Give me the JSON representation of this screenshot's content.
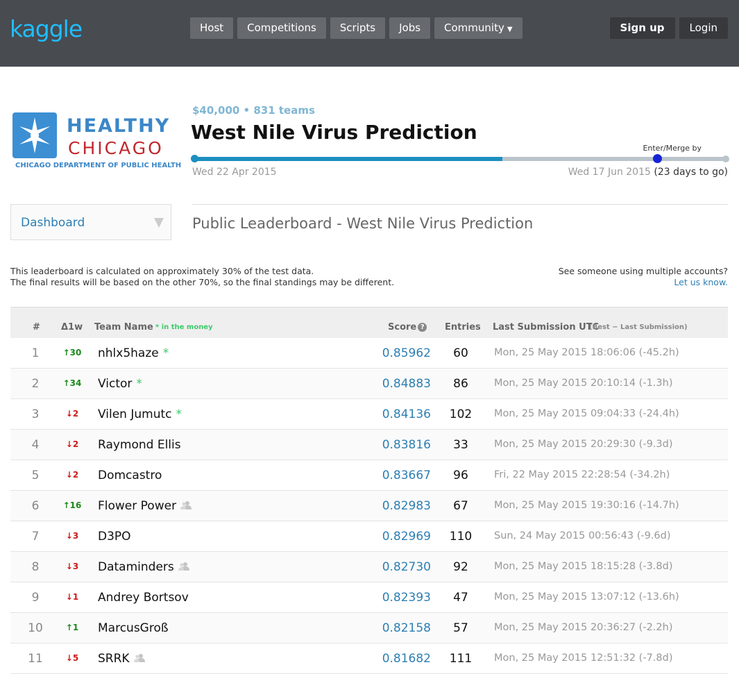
{
  "header": {
    "logo": "kaggle",
    "nav": [
      {
        "label": "Host"
      },
      {
        "label": "Competitions"
      },
      {
        "label": "Scripts"
      },
      {
        "label": "Jobs"
      },
      {
        "label": "Community"
      }
    ],
    "signup_label": "Sign up",
    "login_label": "Login"
  },
  "competition": {
    "sponsor": {
      "line1": "HEALTHY",
      "line2": "CHICAGO",
      "line3": "CHICAGO DEPARTMENT OF PUBLIC HEALTH"
    },
    "prize_teams": "$40,000 • 831 teams",
    "title": "West Nile Virus Prediction",
    "timeline": {
      "progress_fraction": 0.58,
      "enter_merge_fraction": 0.87,
      "enter_label": "Enter/Merge by",
      "start_date": "Wed 22 Apr 2015",
      "end_date": "Wed 17 Jun 2015",
      "days_to_go": "(23 days to go)"
    }
  },
  "dashboard": {
    "label": "Dashboard"
  },
  "leaderboard": {
    "title": "Public Leaderboard - West Nile Virus Prediction",
    "note_line1": "This leaderboard is calculated on approximately 30% of the test data.",
    "note_line2": "The final results will be based on the other 70%, so the final standings may be different.",
    "report_line1": "See someone using multiple accounts?",
    "report_link": "Let us know.",
    "columns": {
      "rank": "#",
      "delta": "Δ1w",
      "team": "Team Name",
      "money": "* in the money",
      "score": "Score",
      "entries": "Entries",
      "last": "Last Submission UTC",
      "last_sub": "(Best − Last Submission)"
    },
    "rows": [
      {
        "rank": "1",
        "delta": "↑30",
        "dir": "up",
        "name": "nhlx5haze",
        "money": true,
        "team": false,
        "score": "0.85962",
        "entries": "60",
        "last": "Mon, 25 May 2015 18:06:06 (-45.2h)"
      },
      {
        "rank": "2",
        "delta": "↑34",
        "dir": "up",
        "name": "Victor",
        "money": true,
        "team": false,
        "score": "0.84883",
        "entries": "86",
        "last": "Mon, 25 May 2015 20:10:14 (-1.3h)"
      },
      {
        "rank": "3",
        "delta": "↓2",
        "dir": "down",
        "name": "Vilen Jumutc",
        "money": true,
        "team": false,
        "score": "0.84136",
        "entries": "102",
        "last": "Mon, 25 May 2015 09:04:33 (-24.4h)"
      },
      {
        "rank": "4",
        "delta": "↓2",
        "dir": "down",
        "name": "Raymond Ellis",
        "money": false,
        "team": false,
        "score": "0.83816",
        "entries": "33",
        "last": "Mon, 25 May 2015 20:29:30 (-9.3d)"
      },
      {
        "rank": "5",
        "delta": "↓2",
        "dir": "down",
        "name": "Domcastro",
        "money": false,
        "team": false,
        "score": "0.83667",
        "entries": "96",
        "last": "Fri, 22 May 2015 22:28:54 (-34.2h)"
      },
      {
        "rank": "6",
        "delta": "↑16",
        "dir": "up",
        "name": "Flower Power",
        "money": false,
        "team": true,
        "score": "0.82983",
        "entries": "67",
        "last": "Mon, 25 May 2015 19:30:16 (-14.7h)"
      },
      {
        "rank": "7",
        "delta": "↓3",
        "dir": "down",
        "name": "D3PO",
        "money": false,
        "team": false,
        "score": "0.82969",
        "entries": "110",
        "last": "Sun, 24 May 2015 00:56:43 (-9.6d)"
      },
      {
        "rank": "8",
        "delta": "↓3",
        "dir": "down",
        "name": "Dataminders",
        "money": false,
        "team": true,
        "score": "0.82730",
        "entries": "92",
        "last": "Mon, 25 May 2015 18:15:28 (-3.8d)"
      },
      {
        "rank": "9",
        "delta": "↓1",
        "dir": "down",
        "name": "Andrey Bortsov",
        "money": false,
        "team": false,
        "score": "0.82393",
        "entries": "47",
        "last": "Mon, 25 May 2015 13:07:12 (-13.6h)"
      },
      {
        "rank": "10",
        "delta": "↑1",
        "dir": "up",
        "name": "MarcusGroß",
        "money": false,
        "team": false,
        "score": "0.82158",
        "entries": "57",
        "last": "Mon, 25 May 2015 20:36:27 (-2.2h)"
      },
      {
        "rank": "11",
        "delta": "↓5",
        "dir": "down",
        "name": "SRRK",
        "money": false,
        "team": true,
        "score": "0.81682",
        "entries": "111",
        "last": "Mon, 25 May 2015 12:51:32 (-7.8d)"
      }
    ]
  }
}
